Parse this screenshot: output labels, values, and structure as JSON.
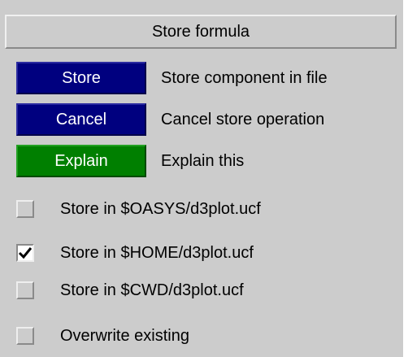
{
  "panel": {
    "title": "Store formula"
  },
  "buttons": [
    {
      "label": "Store",
      "description": "Store component in file",
      "color": "#00007f"
    },
    {
      "label": "Cancel",
      "description": "Cancel store operation",
      "color": "#00007f"
    },
    {
      "label": "Explain",
      "description": "Explain this",
      "color": "#007f00"
    }
  ],
  "options": [
    {
      "label": "Store in $OASYS/d3plot.ucf",
      "checked": false
    },
    {
      "label": "Store in $HOME/d3plot.ucf",
      "checked": true
    },
    {
      "label": "Store in $CWD/d3plot.ucf",
      "checked": false
    },
    {
      "label": "Overwrite existing",
      "checked": false
    }
  ],
  "icons": {
    "checked_mark": "checkmark-icon"
  }
}
